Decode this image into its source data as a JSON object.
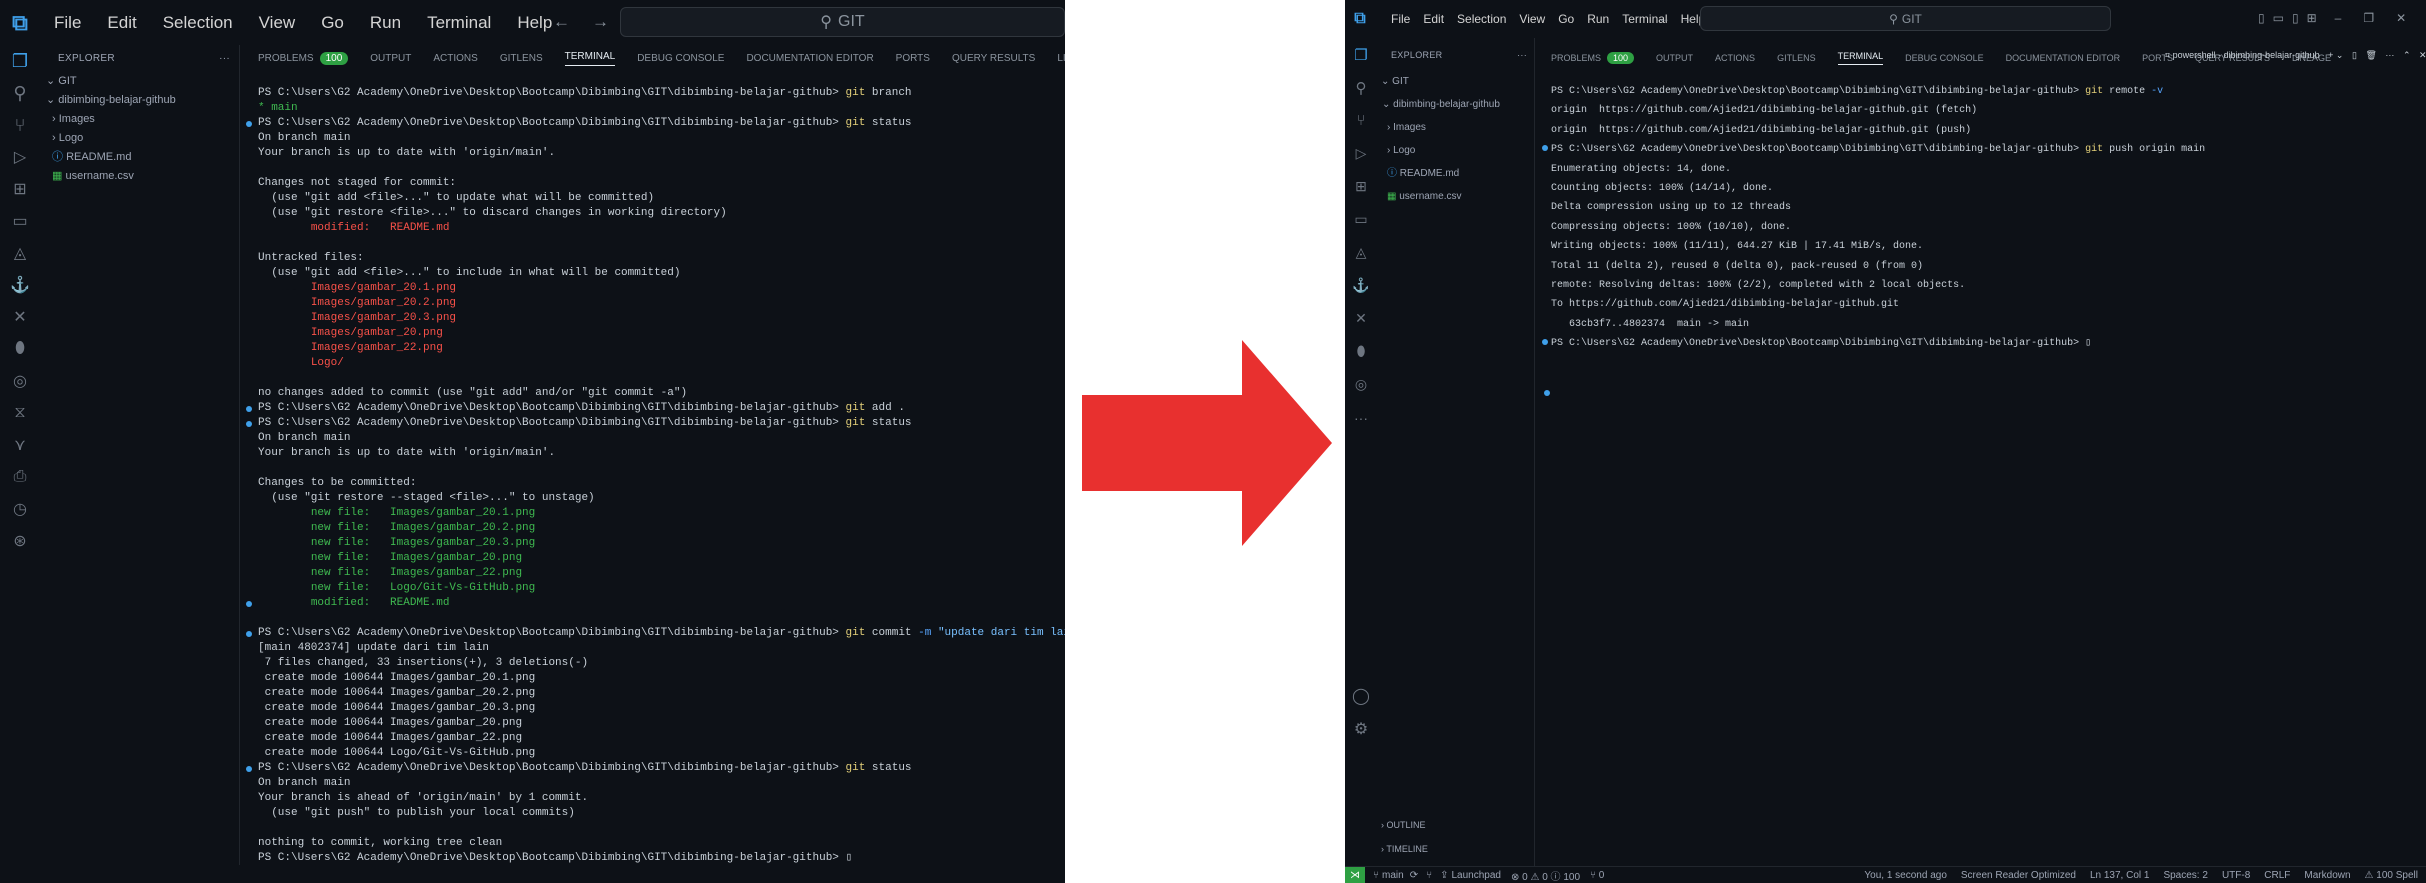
{
  "left": {
    "menu": [
      "File",
      "Edit",
      "Selection",
      "View",
      "Go",
      "Run",
      "Terminal",
      "Help"
    ],
    "search_placeholder": "GIT",
    "explorer": {
      "title": "EXPLORER",
      "more": "···",
      "root": "GIT",
      "items": [
        {
          "label": "dibimbing-belajar-github",
          "kind": "folder-open",
          "indent": 1
        },
        {
          "label": "Images",
          "kind": "folder",
          "indent": 2
        },
        {
          "label": "Logo",
          "kind": "folder",
          "indent": 2
        },
        {
          "label": "README.md",
          "kind": "md",
          "indent": 2
        },
        {
          "label": "username.csv",
          "kind": "csv",
          "indent": 2
        }
      ]
    },
    "tabs": [
      "PROBLEMS",
      "OUTPUT",
      "ACTIONS",
      "GITLENS",
      "TERMINAL",
      "DEBUG CONSOLE",
      "DOCUMENTATION EDITOR",
      "PORTS",
      "QUERY RESULTS",
      "LINEAGE"
    ],
    "problems_count": "100",
    "active_tab": "TERMINAL",
    "terminal": [
      {
        "dot": false,
        "parts": [
          [
            "p",
            "PS C:\\Users\\G2 Academy\\OneDrive\\Desktop\\Bootcamp\\Dibimbing\\GIT\\dibimbing-belajar-github> "
          ],
          [
            "cmd",
            "git"
          ],
          [
            "p",
            " branch"
          ]
        ]
      },
      {
        "dot": false,
        "parts": [
          [
            "green",
            "* main"
          ]
        ]
      },
      {
        "dot": true,
        "parts": [
          [
            "p",
            "PS C:\\Users\\G2 Academy\\OneDrive\\Desktop\\Bootcamp\\Dibimbing\\GIT\\dibimbing-belajar-github> "
          ],
          [
            "cmd",
            "git"
          ],
          [
            "p",
            " status"
          ]
        ]
      },
      {
        "dot": false,
        "parts": [
          [
            "p",
            "On branch main"
          ]
        ]
      },
      {
        "dot": false,
        "parts": [
          [
            "p",
            "Your branch is up to date with 'origin/main'."
          ]
        ]
      },
      {
        "dot": false,
        "parts": [
          [
            "p",
            ""
          ]
        ]
      },
      {
        "dot": false,
        "parts": [
          [
            "p",
            "Changes not staged for commit:"
          ]
        ]
      },
      {
        "dot": false,
        "parts": [
          [
            "p",
            "  (use \"git add <file>...\" to update what will be committed)"
          ]
        ]
      },
      {
        "dot": false,
        "parts": [
          [
            "p",
            "  (use \"git restore <file>...\" to discard changes in working directory)"
          ]
        ]
      },
      {
        "dot": false,
        "parts": [
          [
            "p",
            "        "
          ],
          [
            "red",
            "modified:   README.md"
          ]
        ]
      },
      {
        "dot": false,
        "parts": [
          [
            "p",
            ""
          ]
        ]
      },
      {
        "dot": false,
        "parts": [
          [
            "p",
            "Untracked files:"
          ]
        ]
      },
      {
        "dot": false,
        "parts": [
          [
            "p",
            "  (use \"git add <file>...\" to include in what will be committed)"
          ]
        ]
      },
      {
        "dot": false,
        "parts": [
          [
            "p",
            "        "
          ],
          [
            "red",
            "Images/gambar_20.1.png"
          ]
        ]
      },
      {
        "dot": false,
        "parts": [
          [
            "p",
            "        "
          ],
          [
            "red",
            "Images/gambar_20.2.png"
          ]
        ]
      },
      {
        "dot": false,
        "parts": [
          [
            "p",
            "        "
          ],
          [
            "red",
            "Images/gambar_20.3.png"
          ]
        ]
      },
      {
        "dot": false,
        "parts": [
          [
            "p",
            "        "
          ],
          [
            "red",
            "Images/gambar_20.png"
          ]
        ]
      },
      {
        "dot": false,
        "parts": [
          [
            "p",
            "        "
          ],
          [
            "red",
            "Images/gambar_22.png"
          ]
        ]
      },
      {
        "dot": false,
        "parts": [
          [
            "p",
            "        "
          ],
          [
            "red",
            "Logo/"
          ]
        ]
      },
      {
        "dot": false,
        "parts": [
          [
            "p",
            ""
          ]
        ]
      },
      {
        "dot": false,
        "parts": [
          [
            "p",
            "no changes added to commit (use \"git add\" and/or \"git commit -a\")"
          ]
        ]
      },
      {
        "dot": true,
        "parts": [
          [
            "p",
            "PS C:\\Users\\G2 Academy\\OneDrive\\Desktop\\Bootcamp\\Dibimbing\\GIT\\dibimbing-belajar-github> "
          ],
          [
            "cmd",
            "git"
          ],
          [
            "p",
            " add ."
          ]
        ]
      },
      {
        "dot": true,
        "parts": [
          [
            "p",
            "PS C:\\Users\\G2 Academy\\OneDrive\\Desktop\\Bootcamp\\Dibimbing\\GIT\\dibimbing-belajar-github> "
          ],
          [
            "cmd",
            "git"
          ],
          [
            "p",
            " status"
          ]
        ]
      },
      {
        "dot": false,
        "parts": [
          [
            "p",
            "On branch main"
          ]
        ]
      },
      {
        "dot": false,
        "parts": [
          [
            "p",
            "Your branch is up to date with 'origin/main'."
          ]
        ]
      },
      {
        "dot": false,
        "parts": [
          [
            "p",
            ""
          ]
        ]
      },
      {
        "dot": false,
        "parts": [
          [
            "p",
            "Changes to be committed:"
          ]
        ]
      },
      {
        "dot": false,
        "parts": [
          [
            "p",
            "  (use \"git restore --staged <file>...\" to unstage)"
          ]
        ]
      },
      {
        "dot": false,
        "parts": [
          [
            "p",
            "        "
          ],
          [
            "green",
            "new file:   Images/gambar_20.1.png"
          ]
        ]
      },
      {
        "dot": false,
        "parts": [
          [
            "p",
            "        "
          ],
          [
            "green",
            "new file:   Images/gambar_20.2.png"
          ]
        ]
      },
      {
        "dot": false,
        "parts": [
          [
            "p",
            "        "
          ],
          [
            "green",
            "new file:   Images/gambar_20.3.png"
          ]
        ]
      },
      {
        "dot": false,
        "parts": [
          [
            "p",
            "        "
          ],
          [
            "green",
            "new file:   Images/gambar_20.png"
          ]
        ]
      },
      {
        "dot": false,
        "parts": [
          [
            "p",
            "        "
          ],
          [
            "green",
            "new file:   Images/gambar_22.png"
          ]
        ]
      },
      {
        "dot": false,
        "parts": [
          [
            "p",
            "        "
          ],
          [
            "green",
            "new file:   Logo/Git-Vs-GitHub.png"
          ]
        ]
      },
      {
        "dot": true,
        "parts": [
          [
            "p",
            "        "
          ],
          [
            "green",
            "modified:   README.md"
          ]
        ]
      },
      {
        "dot": false,
        "parts": [
          [
            "p",
            ""
          ]
        ]
      },
      {
        "dot": true,
        "parts": [
          [
            "p",
            "PS C:\\Users\\G2 Academy\\OneDrive\\Desktop\\Bootcamp\\Dibimbing\\GIT\\dibimbing-belajar-github> "
          ],
          [
            "cmd",
            "git"
          ],
          [
            "p",
            " commit "
          ],
          [
            "blue",
            "-m"
          ],
          [
            "p",
            " "
          ],
          [
            "str",
            "\"update dari tim lain\""
          ]
        ]
      },
      {
        "dot": false,
        "parts": [
          [
            "p",
            "[main 4802374] update dari tim lain"
          ]
        ]
      },
      {
        "dot": false,
        "parts": [
          [
            "p",
            " 7 files changed, 33 insertions(+), 3 deletions(-)"
          ]
        ]
      },
      {
        "dot": false,
        "parts": [
          [
            "p",
            " create mode 100644 Images/gambar_20.1.png"
          ]
        ]
      },
      {
        "dot": false,
        "parts": [
          [
            "p",
            " create mode 100644 Images/gambar_20.2.png"
          ]
        ]
      },
      {
        "dot": false,
        "parts": [
          [
            "p",
            " create mode 100644 Images/gambar_20.3.png"
          ]
        ]
      },
      {
        "dot": false,
        "parts": [
          [
            "p",
            " create mode 100644 Images/gambar_20.png"
          ]
        ]
      },
      {
        "dot": false,
        "parts": [
          [
            "p",
            " create mode 100644 Images/gambar_22.png"
          ]
        ]
      },
      {
        "dot": false,
        "parts": [
          [
            "p",
            " create mode 100644 Logo/Git-Vs-GitHub.png"
          ]
        ]
      },
      {
        "dot": true,
        "parts": [
          [
            "p",
            "PS C:\\Users\\G2 Academy\\OneDrive\\Desktop\\Bootcamp\\Dibimbing\\GIT\\dibimbing-belajar-github> "
          ],
          [
            "cmd",
            "git"
          ],
          [
            "p",
            " status"
          ]
        ]
      },
      {
        "dot": false,
        "parts": [
          [
            "p",
            "On branch main"
          ]
        ]
      },
      {
        "dot": false,
        "parts": [
          [
            "p",
            "Your branch is ahead of 'origin/main' by 1 commit."
          ]
        ]
      },
      {
        "dot": false,
        "parts": [
          [
            "p",
            "  (use \"git push\" to publish your local commits)"
          ]
        ]
      },
      {
        "dot": false,
        "parts": [
          [
            "p",
            ""
          ]
        ]
      },
      {
        "dot": false,
        "parts": [
          [
            "p",
            "nothing to commit, working tree clean"
          ]
        ]
      },
      {
        "dot": false,
        "parts": [
          [
            "p",
            "PS C:\\Users\\G2 Academy\\OneDrive\\Desktop\\Bootcamp\\Dibimbing\\GIT\\dibimbing-belajar-github> "
          ],
          [
            "cur",
            "▯"
          ]
        ]
      }
    ]
  },
  "right": {
    "menu": [
      "File",
      "Edit",
      "Selection",
      "View",
      "Go",
      "Run",
      "Terminal",
      "Help"
    ],
    "search_placeholder": "GIT",
    "explorer": {
      "title": "EXPLORER",
      "more": "···",
      "root": "GIT",
      "items": [
        {
          "label": "dibimbing-belajar-github",
          "kind": "folder-open",
          "indent": 1
        },
        {
          "label": "Images",
          "kind": "folder",
          "indent": 2
        },
        {
          "label": "Logo",
          "kind": "folder",
          "indent": 2
        },
        {
          "label": "README.md",
          "kind": "md",
          "indent": 2
        },
        {
          "label": "username.csv",
          "kind": "csv",
          "indent": 2
        }
      ],
      "outline": "OUTLINE",
      "timeline": "TIMELINE"
    },
    "tabs": [
      "PROBLEMS",
      "OUTPUT",
      "ACTIONS",
      "GITLENS",
      "TERMINAL",
      "DEBUG CONSOLE",
      "DOCUMENTATION EDITOR",
      "PORTS",
      "QUERY RESULTS",
      "LINEAGE"
    ],
    "problems_count": "100",
    "active_tab": "TERMINAL",
    "shell_label": "powershell - dibimbing-belajar-github",
    "terminal": [
      {
        "dot": false,
        "parts": [
          [
            "p",
            "PS C:\\Users\\G2 Academy\\OneDrive\\Desktop\\Bootcamp\\Dibimbing\\GIT\\dibimbing-belajar-github> "
          ],
          [
            "cmd",
            "git"
          ],
          [
            "p",
            " remote "
          ],
          [
            "blue",
            "-v"
          ]
        ]
      },
      {
        "dot": false,
        "parts": [
          [
            "p",
            "origin  https://github.com/Ajied21/dibimbing-belajar-github.git (fetch)"
          ]
        ]
      },
      {
        "dot": false,
        "parts": [
          [
            "p",
            "origin  https://github.com/Ajied21/dibimbing-belajar-github.git (push)"
          ]
        ]
      },
      {
        "dot": true,
        "parts": [
          [
            "p",
            "PS C:\\Users\\G2 Academy\\OneDrive\\Desktop\\Bootcamp\\Dibimbing\\GIT\\dibimbing-belajar-github> "
          ],
          [
            "cmd",
            "git"
          ],
          [
            "p",
            " push origin main"
          ]
        ]
      },
      {
        "dot": false,
        "parts": [
          [
            "p",
            "Enumerating objects: 14, done."
          ]
        ]
      },
      {
        "dot": false,
        "parts": [
          [
            "p",
            "Counting objects: 100% (14/14), done."
          ]
        ]
      },
      {
        "dot": false,
        "parts": [
          [
            "p",
            "Delta compression using up to 12 threads"
          ]
        ]
      },
      {
        "dot": false,
        "parts": [
          [
            "p",
            "Compressing objects: 100% (10/10), done."
          ]
        ]
      },
      {
        "dot": false,
        "parts": [
          [
            "p",
            "Writing objects: 100% (11/11), 644.27 KiB | 17.41 MiB/s, done."
          ]
        ]
      },
      {
        "dot": false,
        "parts": [
          [
            "p",
            "Total 11 (delta 2), reused 0 (delta 0), pack-reused 0 (from 0)"
          ]
        ]
      },
      {
        "dot": false,
        "parts": [
          [
            "p",
            "remote: Resolving deltas: 100% (2/2), completed with 2 local objects."
          ]
        ]
      },
      {
        "dot": false,
        "parts": [
          [
            "p",
            "To https://github.com/Ajied21/dibimbing-belajar-github.git"
          ]
        ]
      },
      {
        "dot": false,
        "parts": [
          [
            "p",
            "   63cb3f7..4802374  main -> main"
          ]
        ]
      },
      {
        "dot": true,
        "parts": [
          [
            "p",
            "PS C:\\Users\\G2 Academy\\OneDrive\\Desktop\\Bootcamp\\Dibimbing\\GIT\\dibimbing-belajar-github> "
          ],
          [
            "cur",
            "▯"
          ]
        ]
      }
    ],
    "status": {
      "branch": "main",
      "launchpad": "Launchpad",
      "problems": "⊗ 0 ⚠ 0 ⓘ 100",
      "ports": "⑂ 0",
      "blame": "You, 1 second ago",
      "screen_reader": "Screen Reader Optimized",
      "position": "Ln 137, Col 1",
      "spaces": "Spaces: 2",
      "encoding": "UTF-8",
      "eol": "CRLF",
      "language": "Markdown",
      "spell": "⚠ 100 Spell"
    }
  },
  "colors": {
    "bg": "#0d1117",
    "arrow": "#e8302f",
    "accent": "#3fa0ea",
    "badge": "#2ea043"
  }
}
